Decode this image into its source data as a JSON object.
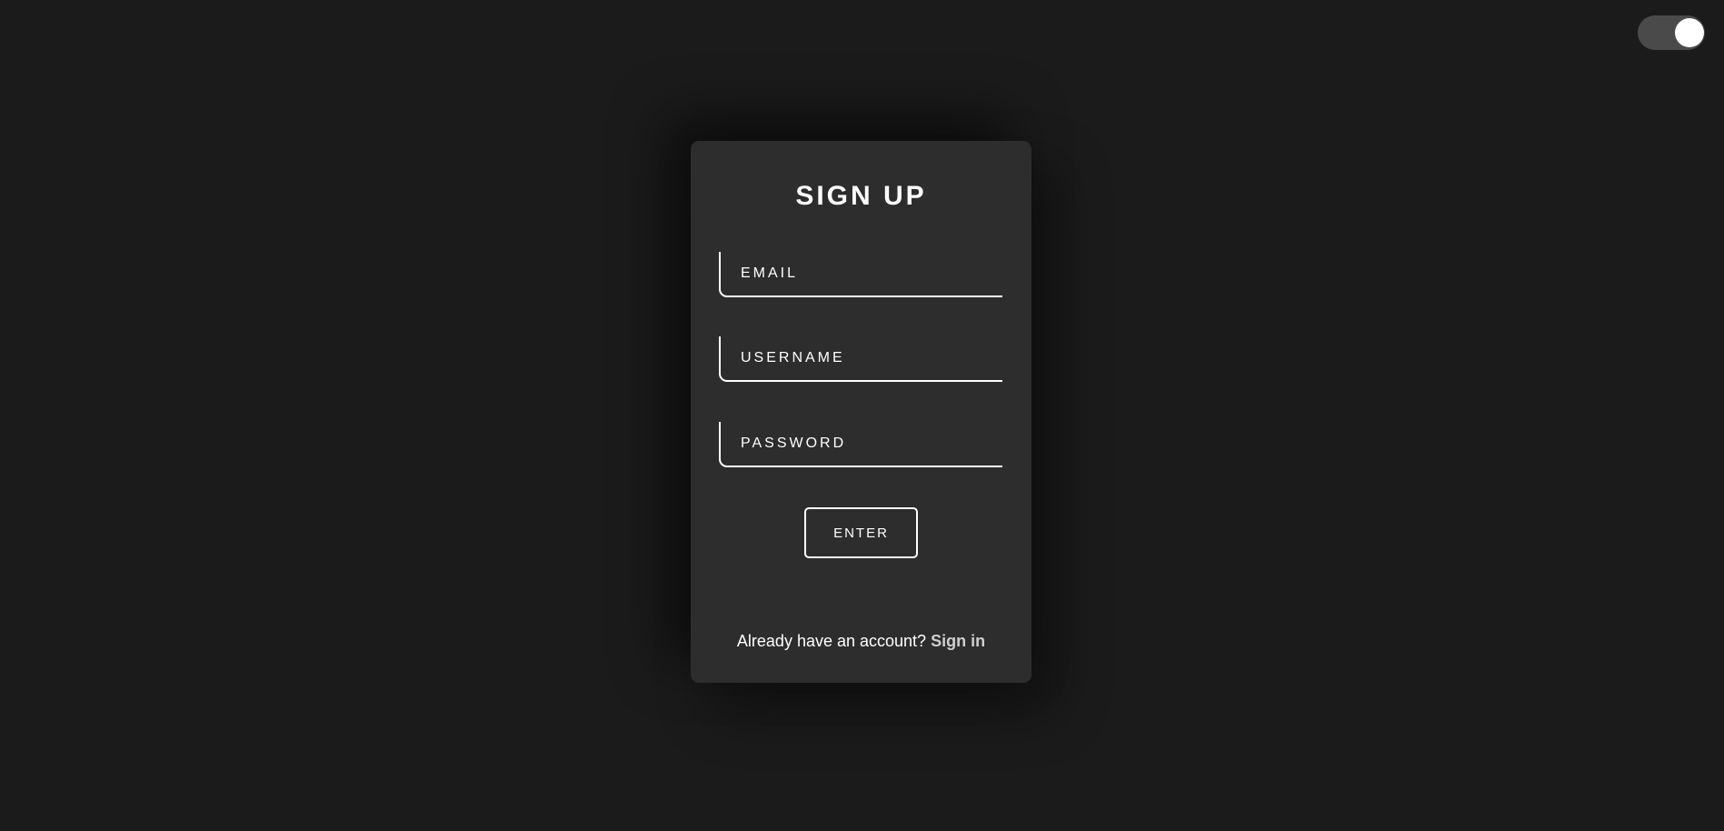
{
  "theme_toggle": {
    "state": "on",
    "track_color": "#4a4a4a",
    "knob_color": "#ffffff"
  },
  "form": {
    "title": "SIGN UP",
    "fields": {
      "email": {
        "placeholder": "EMAIL",
        "value": ""
      },
      "username": {
        "placeholder": "USERNAME",
        "value": ""
      },
      "password": {
        "placeholder": "PASSWORD",
        "value": ""
      }
    },
    "submit_label": "ENTER",
    "footer_text": "Already have an account?",
    "footer_link": "Sign in"
  },
  "colors": {
    "background": "#1b1b1b",
    "card": "#2d2d2d",
    "text": "#ffffff",
    "link": "#cfcfcf"
  }
}
